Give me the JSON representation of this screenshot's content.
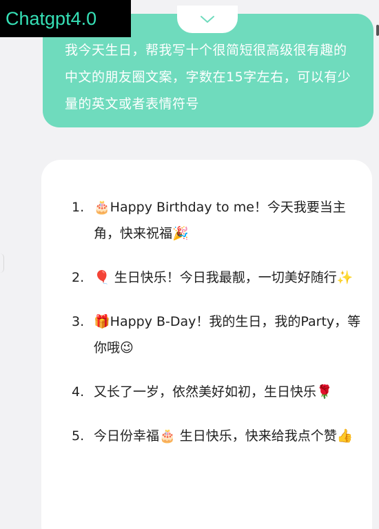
{
  "watermark": {
    "label": "Chatgpt4.0"
  },
  "user_message": {
    "text": "我今天生日，帮我写十个很简短很高级很有趣的中文的朋友圈文案，字数在15字左右，可以有少量的英文或者表情符号"
  },
  "collapse_icon": "chevron-down-icon",
  "colors": {
    "accent": "#6fdbbd",
    "watermark_text": "#36e0b6",
    "background": "#f2f2f4",
    "card": "#ffffff",
    "text": "#1f1f1f"
  },
  "reply": {
    "items": [
      {
        "num": "1.",
        "text": "🎂Happy Birthday to me！今天我要当主角，快来祝福🎉"
      },
      {
        "num": "2.",
        "text": "🎈 生日快乐！今日我最靓，一切美好随行✨"
      },
      {
        "num": "3.",
        "text": "🎁Happy B-Day！我的生日，我的Party，等你哦😉"
      },
      {
        "num": "4.",
        "text": "又长了一岁，依然美好如初，生日快乐🌹"
      },
      {
        "num": "5.",
        "text": "今日份幸福🎂 生日快乐，快来给我点个赞👍"
      }
    ]
  }
}
